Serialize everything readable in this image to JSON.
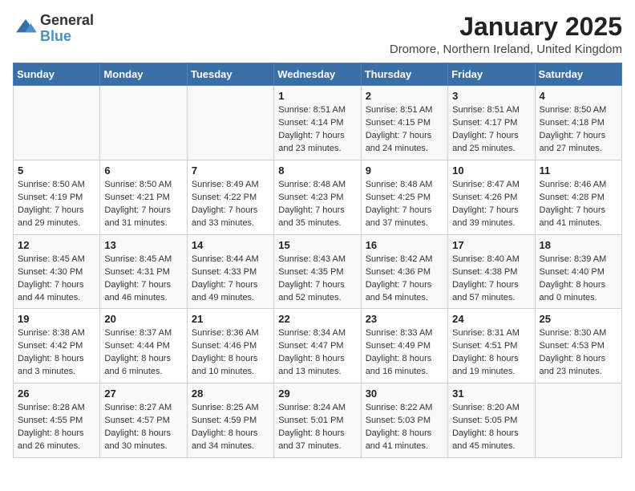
{
  "header": {
    "logo_general": "General",
    "logo_blue": "Blue",
    "title": "January 2025",
    "subtitle": "Dromore, Northern Ireland, United Kingdom"
  },
  "days_of_week": [
    "Sunday",
    "Monday",
    "Tuesday",
    "Wednesday",
    "Thursday",
    "Friday",
    "Saturday"
  ],
  "weeks": [
    [
      {
        "day": "",
        "content": ""
      },
      {
        "day": "",
        "content": ""
      },
      {
        "day": "",
        "content": ""
      },
      {
        "day": "1",
        "content": "Sunrise: 8:51 AM\nSunset: 4:14 PM\nDaylight: 7 hours\nand 23 minutes."
      },
      {
        "day": "2",
        "content": "Sunrise: 8:51 AM\nSunset: 4:15 PM\nDaylight: 7 hours\nand 24 minutes."
      },
      {
        "day": "3",
        "content": "Sunrise: 8:51 AM\nSunset: 4:17 PM\nDaylight: 7 hours\nand 25 minutes."
      },
      {
        "day": "4",
        "content": "Sunrise: 8:50 AM\nSunset: 4:18 PM\nDaylight: 7 hours\nand 27 minutes."
      }
    ],
    [
      {
        "day": "5",
        "content": "Sunrise: 8:50 AM\nSunset: 4:19 PM\nDaylight: 7 hours\nand 29 minutes."
      },
      {
        "day": "6",
        "content": "Sunrise: 8:50 AM\nSunset: 4:21 PM\nDaylight: 7 hours\nand 31 minutes."
      },
      {
        "day": "7",
        "content": "Sunrise: 8:49 AM\nSunset: 4:22 PM\nDaylight: 7 hours\nand 33 minutes."
      },
      {
        "day": "8",
        "content": "Sunrise: 8:48 AM\nSunset: 4:23 PM\nDaylight: 7 hours\nand 35 minutes."
      },
      {
        "day": "9",
        "content": "Sunrise: 8:48 AM\nSunset: 4:25 PM\nDaylight: 7 hours\nand 37 minutes."
      },
      {
        "day": "10",
        "content": "Sunrise: 8:47 AM\nSunset: 4:26 PM\nDaylight: 7 hours\nand 39 minutes."
      },
      {
        "day": "11",
        "content": "Sunrise: 8:46 AM\nSunset: 4:28 PM\nDaylight: 7 hours\nand 41 minutes."
      }
    ],
    [
      {
        "day": "12",
        "content": "Sunrise: 8:45 AM\nSunset: 4:30 PM\nDaylight: 7 hours\nand 44 minutes."
      },
      {
        "day": "13",
        "content": "Sunrise: 8:45 AM\nSunset: 4:31 PM\nDaylight: 7 hours\nand 46 minutes."
      },
      {
        "day": "14",
        "content": "Sunrise: 8:44 AM\nSunset: 4:33 PM\nDaylight: 7 hours\nand 49 minutes."
      },
      {
        "day": "15",
        "content": "Sunrise: 8:43 AM\nSunset: 4:35 PM\nDaylight: 7 hours\nand 52 minutes."
      },
      {
        "day": "16",
        "content": "Sunrise: 8:42 AM\nSunset: 4:36 PM\nDaylight: 7 hours\nand 54 minutes."
      },
      {
        "day": "17",
        "content": "Sunrise: 8:40 AM\nSunset: 4:38 PM\nDaylight: 7 hours\nand 57 minutes."
      },
      {
        "day": "18",
        "content": "Sunrise: 8:39 AM\nSunset: 4:40 PM\nDaylight: 8 hours\nand 0 minutes."
      }
    ],
    [
      {
        "day": "19",
        "content": "Sunrise: 8:38 AM\nSunset: 4:42 PM\nDaylight: 8 hours\nand 3 minutes."
      },
      {
        "day": "20",
        "content": "Sunrise: 8:37 AM\nSunset: 4:44 PM\nDaylight: 8 hours\nand 6 minutes."
      },
      {
        "day": "21",
        "content": "Sunrise: 8:36 AM\nSunset: 4:46 PM\nDaylight: 8 hours\nand 10 minutes."
      },
      {
        "day": "22",
        "content": "Sunrise: 8:34 AM\nSunset: 4:47 PM\nDaylight: 8 hours\nand 13 minutes."
      },
      {
        "day": "23",
        "content": "Sunrise: 8:33 AM\nSunset: 4:49 PM\nDaylight: 8 hours\nand 16 minutes."
      },
      {
        "day": "24",
        "content": "Sunrise: 8:31 AM\nSunset: 4:51 PM\nDaylight: 8 hours\nand 19 minutes."
      },
      {
        "day": "25",
        "content": "Sunrise: 8:30 AM\nSunset: 4:53 PM\nDaylight: 8 hours\nand 23 minutes."
      }
    ],
    [
      {
        "day": "26",
        "content": "Sunrise: 8:28 AM\nSunset: 4:55 PM\nDaylight: 8 hours\nand 26 minutes."
      },
      {
        "day": "27",
        "content": "Sunrise: 8:27 AM\nSunset: 4:57 PM\nDaylight: 8 hours\nand 30 minutes."
      },
      {
        "day": "28",
        "content": "Sunrise: 8:25 AM\nSunset: 4:59 PM\nDaylight: 8 hours\nand 34 minutes."
      },
      {
        "day": "29",
        "content": "Sunrise: 8:24 AM\nSunset: 5:01 PM\nDaylight: 8 hours\nand 37 minutes."
      },
      {
        "day": "30",
        "content": "Sunrise: 8:22 AM\nSunset: 5:03 PM\nDaylight: 8 hours\nand 41 minutes."
      },
      {
        "day": "31",
        "content": "Sunrise: 8:20 AM\nSunset: 5:05 PM\nDaylight: 8 hours\nand 45 minutes."
      },
      {
        "day": "",
        "content": ""
      }
    ]
  ]
}
